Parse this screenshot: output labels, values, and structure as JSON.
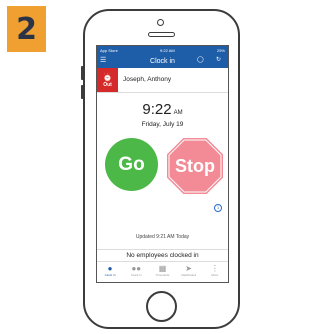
{
  "step_badge": "2",
  "status_bar": {
    "left": "App Store",
    "time": "9:22 AM",
    "right": "25%"
  },
  "header": {
    "title": "Clock in",
    "menu_icon": "hamburger-icon",
    "icons": [
      "history-icon",
      "refresh-icon"
    ]
  },
  "employee": {
    "status_label": "Out",
    "name": "Joseph, Anthony"
  },
  "clock": {
    "time": "9:22",
    "ampm": "AM",
    "date": "Friday, July 19"
  },
  "actions": {
    "go_label": "Go",
    "stop_label": "Stop"
  },
  "updated_text": "Updated 9:21 AM Today",
  "no_employees_text": "No employees clocked in",
  "tabs": [
    {
      "label": "Clock In",
      "icon": "person-icon",
      "active": true
    },
    {
      "label": "Clock In",
      "icon": "group-icon",
      "active": false
    },
    {
      "label": "Timecards",
      "icon": "timecard-icon",
      "active": false
    },
    {
      "label": "Dashboard",
      "icon": "dashboard-icon",
      "active": false
    },
    {
      "label": "More",
      "icon": "more-icon",
      "active": false
    }
  ],
  "colors": {
    "brand": "#1e5ea8",
    "go": "#4cb848",
    "stop": "#f28b96",
    "out": "#d42a2a",
    "badge": "#f0a030"
  }
}
